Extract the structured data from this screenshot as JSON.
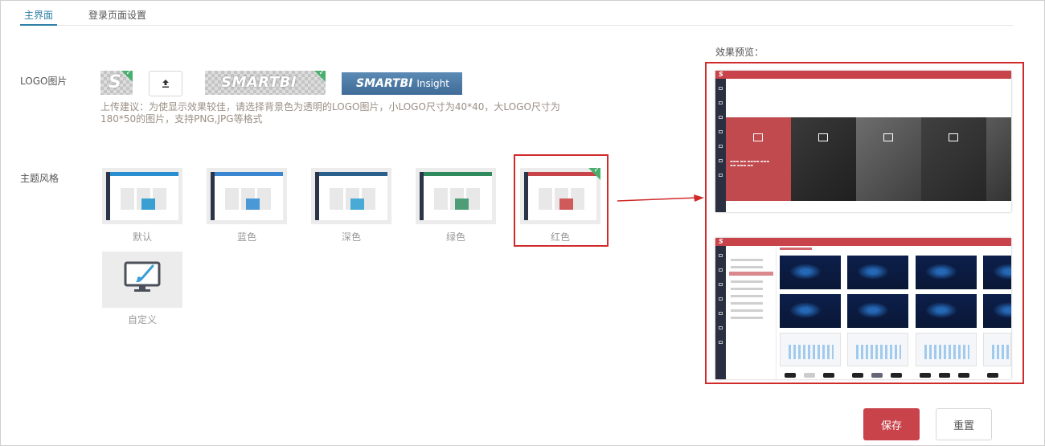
{
  "tabs": [
    {
      "label": "主界面",
      "active": true
    },
    {
      "label": "登录页面设置",
      "active": false
    }
  ],
  "logo": {
    "label": "LOGO图片",
    "small_logo_text": "S",
    "large_logo_text": "SMARTBI",
    "insight_logo_text": "SMARTBI",
    "insight_logo_suffix": "Insight",
    "upload_icon": "upload-icon",
    "hint": "上传建议：为使显示效果较佳，请选择背景色为透明的LOGO图片，小LOGO尺寸为40*40，大LOGO尺寸为180*50的图片，支持PNG,JPG等格式"
  },
  "theme": {
    "label": "主题风格",
    "options": [
      {
        "name": "默认",
        "accent": "#2a8fd0",
        "block": "#3aa0d2",
        "selected": false
      },
      {
        "name": "蓝色",
        "accent": "#3b86d1",
        "block": "#4a98d6",
        "selected": false
      },
      {
        "name": "深色",
        "accent": "#2a5f8c",
        "block": "#4aaad6",
        "selected": false
      },
      {
        "name": "绿色",
        "accent": "#2f8a5e",
        "block": "#4e9d78",
        "selected": false
      },
      {
        "name": "红色",
        "accent": "#c8434a",
        "block": "#d05a5a",
        "selected": true
      }
    ],
    "custom_label": "自定义",
    "custom_icon": "monitor-brush-icon"
  },
  "preview": {
    "title": "效果预览："
  },
  "colors": {
    "primary": "#c8434a",
    "tab_active": "#2d7fa6",
    "selected_border": "#d12a2a",
    "check_badge": "#4aaf6e"
  },
  "buttons": {
    "save": "保存",
    "reset": "重置"
  }
}
